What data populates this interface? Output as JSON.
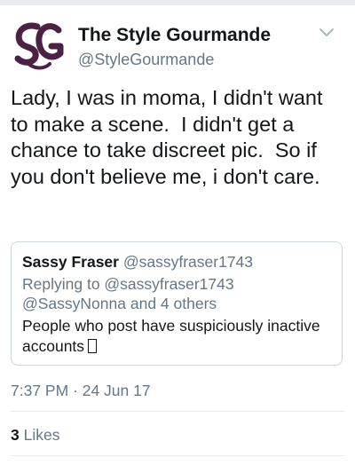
{
  "tweet": {
    "author_name": "The Style Gourmande",
    "author_handle": "@StyleGourmande",
    "avatar_icon": "sg-monogram-logo",
    "menu_icon": "chevron-down-icon",
    "text": "Lady, I was in moma, I didn't want to make a scene.  I didn't get a chance to take discreet pic.  So if you don't believe me, i don't care.",
    "timestamp": "7:37 PM · 24 Jun 17",
    "likes_count": "3",
    "likes_label": "Likes"
  },
  "quoted_tweet": {
    "author_name": "Sassy Fraser",
    "author_handle": "@sassyfraser1743",
    "replying_line1": "Replying to @sassyfraser1743",
    "replying_line2": "@SassyNonna and 4 others",
    "text_line1": "People who post have suspiciously inactive",
    "text_line2": "accounts",
    "emoji_icon": "missing-glyph-box"
  },
  "colors": {
    "text_primary": "#14171a",
    "text_secondary": "#657786",
    "border": "#ccd6dd",
    "avatar_purple": "#4b2145"
  }
}
